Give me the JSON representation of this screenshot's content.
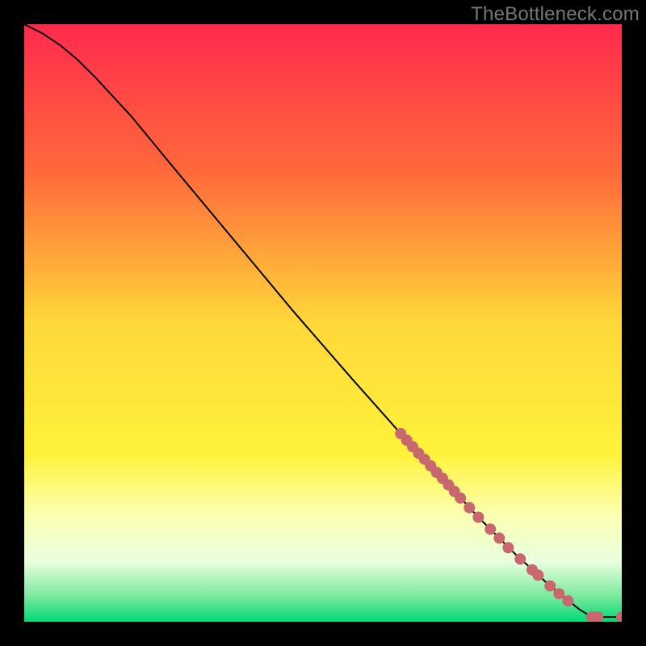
{
  "attribution": "TheBottleneck.com",
  "chart_data": {
    "type": "line",
    "xlabel": "",
    "ylabel": "",
    "xlim": [
      0,
      100
    ],
    "ylim": [
      0,
      100
    ],
    "background_gradient_stops": [
      {
        "pct": 0,
        "color": "#ff2a4d"
      },
      {
        "pct": 25,
        "color": "#ff6a3a"
      },
      {
        "pct": 50,
        "color": "#ffd83a"
      },
      {
        "pct": 72,
        "color": "#fff23a"
      },
      {
        "pct": 82,
        "color": "#fcffb0"
      },
      {
        "pct": 90,
        "color": "#e8ffe0"
      },
      {
        "pct": 96,
        "color": "#74e89a"
      },
      {
        "pct": 100,
        "color": "#00d977"
      }
    ],
    "series": [
      {
        "name": "curve",
        "color": "#000000",
        "width": 2,
        "points": [
          {
            "x": 0,
            "y": 100
          },
          {
            "x": 3,
            "y": 98.5
          },
          {
            "x": 6,
            "y": 96.5
          },
          {
            "x": 9,
            "y": 94.0
          },
          {
            "x": 12,
            "y": 91.0
          },
          {
            "x": 18,
            "y": 84.5
          },
          {
            "x": 25,
            "y": 76.0
          },
          {
            "x": 35,
            "y": 64.0
          },
          {
            "x": 45,
            "y": 52.0
          },
          {
            "x": 55,
            "y": 40.5
          },
          {
            "x": 63,
            "y": 31.5
          },
          {
            "x": 70,
            "y": 24.0
          },
          {
            "x": 76,
            "y": 17.5
          },
          {
            "x": 82,
            "y": 11.5
          },
          {
            "x": 88,
            "y": 6.0
          },
          {
            "x": 93,
            "y": 2.0
          },
          {
            "x": 95,
            "y": 0.8
          },
          {
            "x": 98,
            "y": 0.8
          },
          {
            "x": 100,
            "y": 0.8
          }
        ]
      }
    ],
    "markers": {
      "color": "#c9676e",
      "radius": 7,
      "points": [
        {
          "x": 63,
          "y": 31.5
        },
        {
          "x": 64,
          "y": 30.4
        },
        {
          "x": 65,
          "y": 29.3
        },
        {
          "x": 66,
          "y": 28.2
        },
        {
          "x": 67,
          "y": 27.2
        },
        {
          "x": 68,
          "y": 26.1
        },
        {
          "x": 69,
          "y": 25.0
        },
        {
          "x": 70,
          "y": 24.0
        },
        {
          "x": 71,
          "y": 22.9
        },
        {
          "x": 72,
          "y": 21.8
        },
        {
          "x": 73,
          "y": 20.7
        },
        {
          "x": 74.5,
          "y": 19.1
        },
        {
          "x": 76,
          "y": 17.5
        },
        {
          "x": 78,
          "y": 15.5
        },
        {
          "x": 79.5,
          "y": 14.0
        },
        {
          "x": 81,
          "y": 12.4
        },
        {
          "x": 83,
          "y": 10.5
        },
        {
          "x": 85,
          "y": 8.7
        },
        {
          "x": 86,
          "y": 7.8
        },
        {
          "x": 88,
          "y": 6.0
        },
        {
          "x": 89.5,
          "y": 4.7
        },
        {
          "x": 91,
          "y": 3.5
        },
        {
          "x": 95,
          "y": 0.8
        },
        {
          "x": 96,
          "y": 0.8
        },
        {
          "x": 100,
          "y": 0.8
        }
      ]
    }
  }
}
